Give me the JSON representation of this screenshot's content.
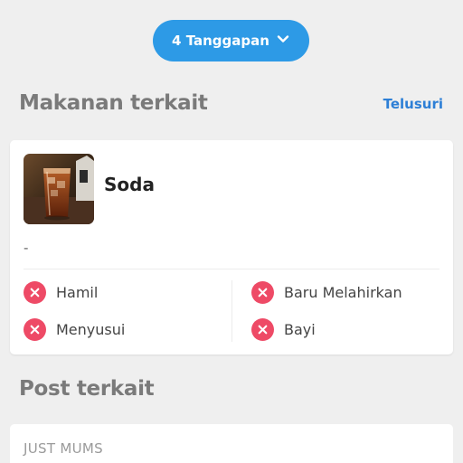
{
  "responses": {
    "label": "4 Tanggapan",
    "icon": "chevron-down-icon"
  },
  "related_food": {
    "title": "Makanan terkait",
    "explore_label": "Telusuri",
    "item": {
      "name": "Soda",
      "description": "-",
      "image": "soda-glass-photo",
      "statuses": [
        {
          "label": "Hamil",
          "icon": "x-circle-icon"
        },
        {
          "label": "Baru Melahirkan",
          "icon": "x-circle-icon"
        },
        {
          "label": "Menyusui",
          "icon": "x-circle-icon"
        },
        {
          "label": "Bayi",
          "icon": "x-circle-icon"
        }
      ]
    }
  },
  "related_posts": {
    "title": "Post terkait",
    "first_post": {
      "category": "JUST MUMS"
    }
  },
  "colors": {
    "accent": "#2d9ae6",
    "link": "#2d7fd6",
    "not_allowed": "#ee4a66",
    "background": "#efefef"
  }
}
